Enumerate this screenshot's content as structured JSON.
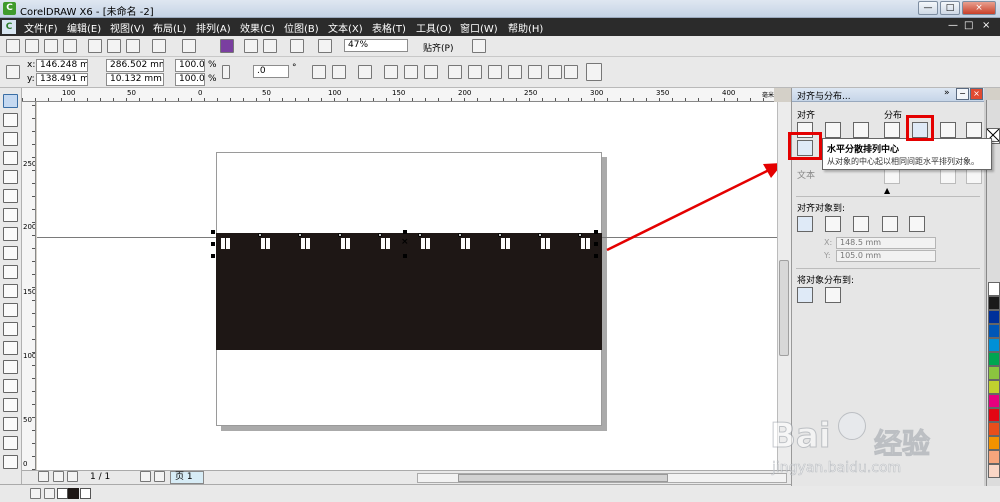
{
  "window": {
    "title": "CorelDRAW X6 - [未命名 -2]",
    "logo_letter": "C",
    "controls": [
      "—",
      "□",
      "×"
    ]
  },
  "menu": {
    "logo_letter": "C",
    "items": [
      "文件(F)",
      "编辑(E)",
      "视图(V)",
      "布局(L)",
      "排列(A)",
      "效果(C)",
      "位图(B)",
      "文本(X)",
      "表格(T)",
      "工具(O)",
      "窗口(W)",
      "帮助(H)"
    ],
    "doc_controls": [
      "—",
      "□",
      "×"
    ]
  },
  "toolbar1": {
    "zoom_value": "47%",
    "snap_label": "贴齐(P)"
  },
  "toolbar2": {
    "x_label": "x:",
    "x_value": "146.248 mm",
    "y_label": "y:",
    "y_value": "138.491 mm",
    "width_value": "286.502 mm",
    "height_value": "10.132 mm",
    "scale_x": "100.0",
    "scale_y": "100.0",
    "percent": "%",
    "rotation_value": ".0",
    "degree": "°"
  },
  "ruler": {
    "h_ticks": [
      "100",
      "50",
      "0",
      "50",
      "100",
      "150",
      "200",
      "250",
      "300",
      "350",
      "400"
    ],
    "v_ticks": [
      "250",
      "200",
      "150",
      "100",
      "50",
      "0"
    ],
    "unit": "毫米"
  },
  "pagebar": {
    "page_count": "1 / 1",
    "page_tab": "页 1"
  },
  "docker": {
    "title": "对齐与分布...",
    "align_label": "对齐",
    "distribute_label": "分布",
    "text_label": "文本",
    "align_to_label": "对齐对象到:",
    "x_field": "148.5 mm",
    "y_field": "105.0 mm",
    "distribute_to_label": "将对象分布到:",
    "x_prefix": "X:",
    "y_prefix": "Y:"
  },
  "tooltip": {
    "title": "水平分散排列中心",
    "description": "从对象的中心起以相同间距水平排列对象。"
  },
  "palette": {
    "colors": [
      "#ffffff",
      "#1a1a1a",
      "#00309a",
      "#0057b7",
      "#0090d7",
      "#00a651",
      "#00a651",
      "#8bc53f",
      "#c0d12e",
      "#e6007e",
      "#e30613",
      "#e94e1b",
      "#f39200",
      "#f6a57c",
      "#f9d6c6",
      "#faf0c8"
    ]
  },
  "watermark": {
    "brand": "Bai",
    "brand2": "经验",
    "url": "jingyan.baidu.com"
  }
}
